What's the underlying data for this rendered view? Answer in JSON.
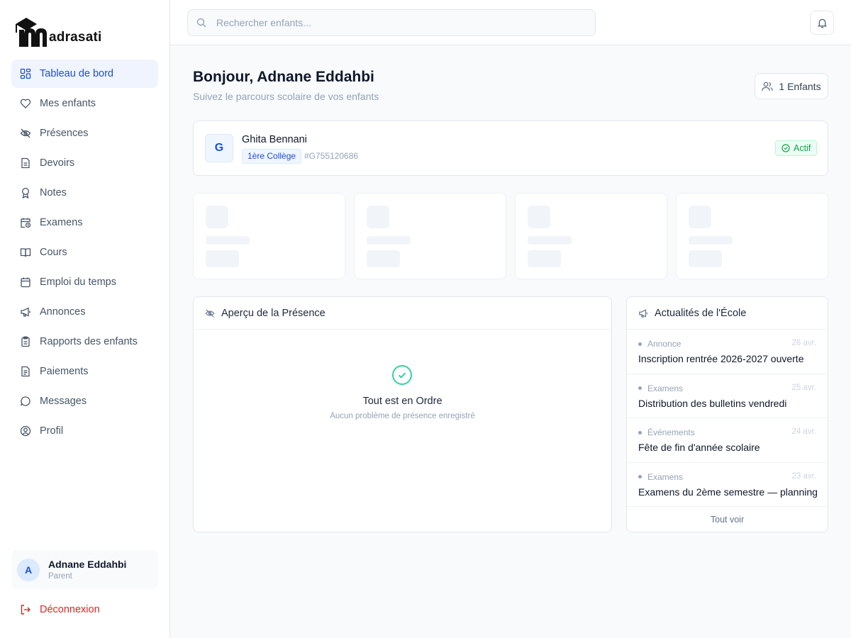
{
  "brand": {
    "logo_text": "adrasati"
  },
  "sidebar": {
    "items": [
      {
        "label": "Tableau de bord",
        "icon": "dashboard-icon",
        "active": true
      },
      {
        "label": "Mes enfants",
        "icon": "heart-icon"
      },
      {
        "label": "Présences",
        "icon": "eye-off-icon"
      },
      {
        "label": "Devoirs",
        "icon": "document-icon"
      },
      {
        "label": "Notes",
        "icon": "award-icon"
      },
      {
        "label": "Examens",
        "icon": "calendar-clock-icon"
      },
      {
        "label": "Cours",
        "icon": "book-open-icon"
      },
      {
        "label": "Emploi du temps",
        "icon": "calendar-icon"
      },
      {
        "label": "Annonces",
        "icon": "megaphone-icon"
      },
      {
        "label": "Rapports des enfants",
        "icon": "clipboard-icon"
      },
      {
        "label": "Paiements",
        "icon": "receipt-icon"
      },
      {
        "label": "Messages",
        "icon": "message-circle-icon"
      },
      {
        "label": "Profil",
        "icon": "user-circle-icon"
      }
    ],
    "user": {
      "initial": "A",
      "name": "Adnane Eddahbi",
      "role": "Parent"
    },
    "logout_label": "Déconnexion"
  },
  "header": {
    "search_placeholder": "Rechercher enfants...",
    "search_value": ""
  },
  "main": {
    "greeting": "Bonjour, Adnane Eddahbi",
    "subtitle": "Suivez le parcours scolaire de vos enfants",
    "children_count_label": "1 Enfants",
    "child": {
      "initial": "G",
      "name": "Ghita Bennani",
      "class": "1ère Collège",
      "id": "#G755120686",
      "status": "Actif"
    },
    "presence": {
      "title": "Aperçu de la Présence",
      "ok_title": "Tout est en Ordre",
      "ok_subtitle": "Aucun problème de présence enregistré"
    },
    "news": {
      "title": "Actualités de l'École",
      "items": [
        {
          "category": "Annonce",
          "date": "26 avr.",
          "title": "Inscription rentrée 2026-2027 ouverte"
        },
        {
          "category": "Examens",
          "date": "25 avr.",
          "title": "Distribution des bulletins vendredi"
        },
        {
          "category": "Événements",
          "date": "24 avr.",
          "title": "Fête de fin d'année scolaire"
        },
        {
          "category": "Examens",
          "date": "23 avr.",
          "title": "Examens du 2ème semestre — planning"
        }
      ],
      "see_all_label": "Tout voir"
    }
  },
  "colors": {
    "accent": "#1d4ed8",
    "active_bg": "#eff4fe",
    "success": "#16a34a",
    "danger": "#dc2626",
    "ok_icon": "#34d399"
  }
}
